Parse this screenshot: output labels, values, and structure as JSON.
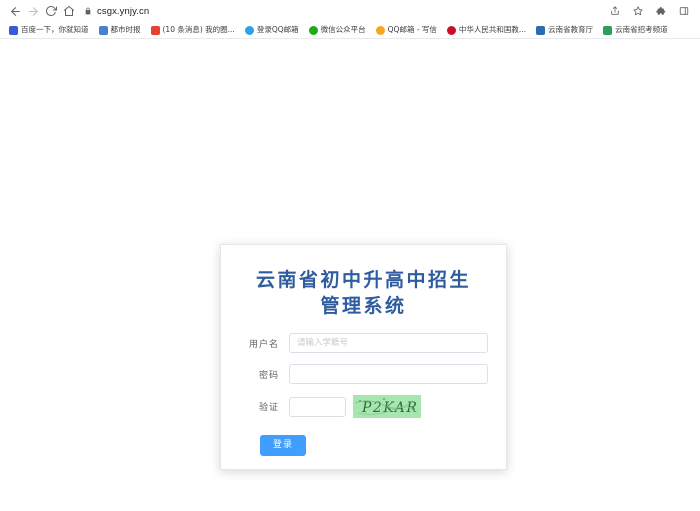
{
  "browser": {
    "url": "csgx.ynjy.cn",
    "nav": {
      "back_icon": "arrow-left-icon",
      "forward_icon": "arrow-right-icon",
      "reload_icon": "reload-icon",
      "home_icon": "home-icon",
      "lock_icon": "lock-icon"
    },
    "toolbar_right": [
      {
        "name": "share-icon",
        "label": "share"
      },
      {
        "name": "bookmark-star-icon",
        "label": "bookmark"
      },
      {
        "name": "extensions-puzzle-icon",
        "label": "extensions"
      },
      {
        "name": "sidebar-panel-icon",
        "label": "side panel"
      }
    ],
    "bookmarks": [
      {
        "label": "百度一下，你就知道",
        "favicon_color": "#3b5bd6"
      },
      {
        "label": "都市时报",
        "favicon_color": "#4a7fd4"
      },
      {
        "label": "(10 条消息) 我的圈...",
        "favicon_color": "#e34234"
      },
      {
        "label": "登录QQ邮箱",
        "favicon_color": "#2aa3e8"
      },
      {
        "label": "微信公众平台",
        "favicon_color": "#1aad19"
      },
      {
        "label": "QQ邮箱 - 写信",
        "favicon_color": "#f5a623"
      },
      {
        "label": "中华人民共和国教...",
        "favicon_color": "#c8102e"
      },
      {
        "label": "云南省教育厅",
        "favicon_color": "#2b6cb0"
      },
      {
        "label": "云南省招考频道",
        "favicon_color": "#2e9e5b"
      }
    ]
  },
  "login": {
    "title_line1": "云南省初中升高中招生",
    "title_line2": "管理系统",
    "title_color": "#2f5c9e",
    "fields": {
      "username_label": "用户名",
      "username_value": "",
      "username_placeholder": "请输入学籍号",
      "password_label": "密码",
      "password_value": "",
      "password_placeholder": "",
      "captcha_label": "验证",
      "captcha_value": "",
      "captcha_placeholder": "",
      "captcha_text": "P2KAR",
      "captcha_bg_color": "#a8e6b0",
      "captcha_text_color": "#2f6b3d"
    },
    "submit_label": "登录",
    "submit_color": "#409eff"
  }
}
